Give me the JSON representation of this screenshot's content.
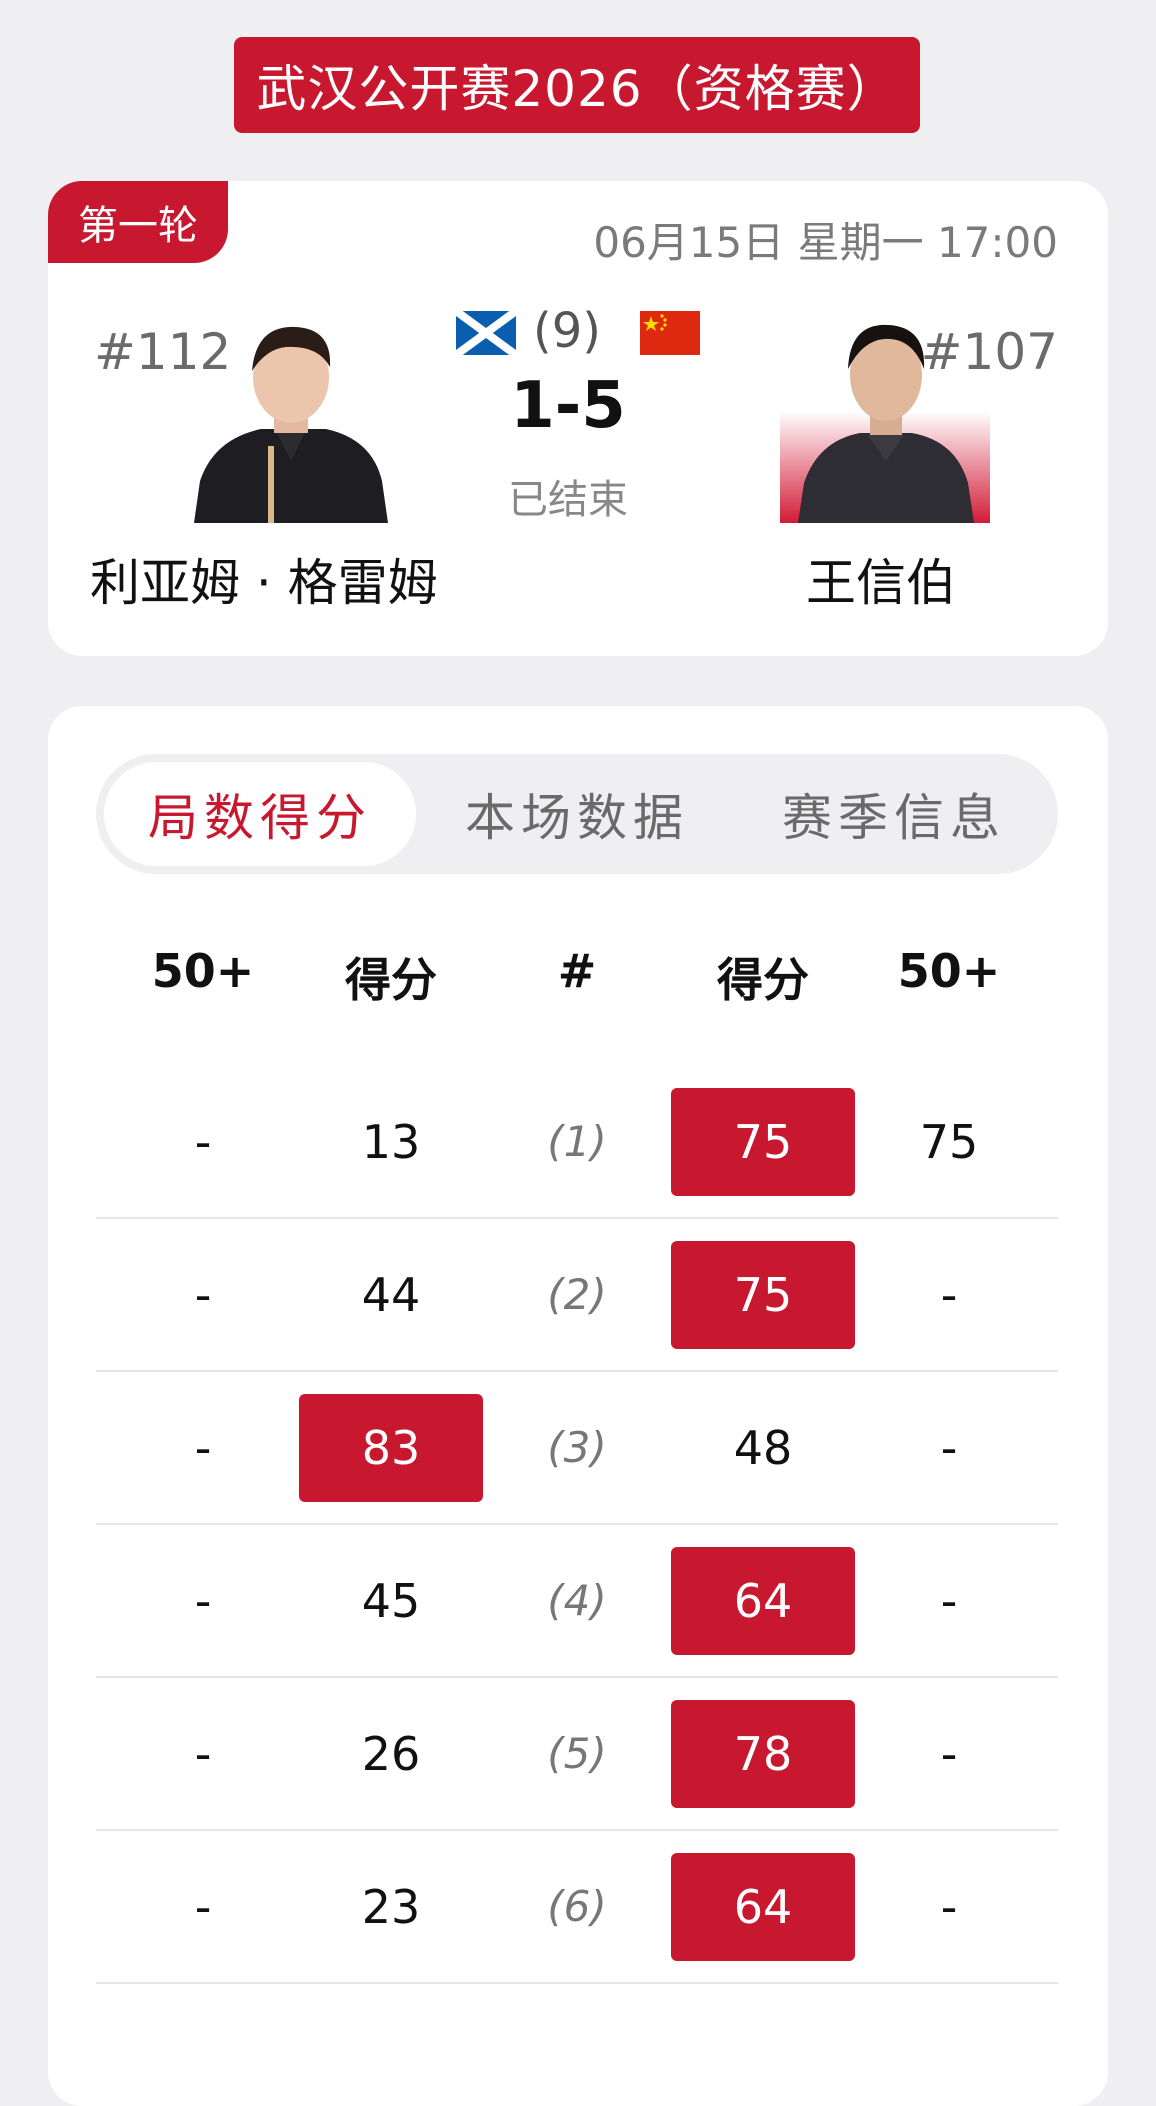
{
  "header": {
    "title": "武汉公开赛2026（资格赛）"
  },
  "match": {
    "round": "第一轮",
    "datetime": "06月15日 星期一 17:00",
    "best_of": "(9)",
    "score": "1-5",
    "status": "已结束",
    "left_player": {
      "rank": "#112",
      "name": "利亚姆 · 格雷姆",
      "flag": "scotland-flag-icon"
    },
    "right_player": {
      "rank": "#107",
      "name": "王信伯",
      "flag": "china-flag-icon"
    }
  },
  "tabs": [
    {
      "label": "局数得分",
      "active": true
    },
    {
      "label": "本场数据",
      "active": false
    },
    {
      "label": "赛季信息",
      "active": false
    }
  ],
  "frames": {
    "headers": [
      "50+",
      "得分",
      "#",
      "得分",
      "50+"
    ],
    "rows": [
      {
        "left_50": "-",
        "left_score": "13",
        "frame": "(1)",
        "right_score": "75",
        "right_50": "75",
        "winner": "right"
      },
      {
        "left_50": "-",
        "left_score": "44",
        "frame": "(2)",
        "right_score": "75",
        "right_50": "-",
        "winner": "right"
      },
      {
        "left_50": "-",
        "left_score": "83",
        "frame": "(3)",
        "right_score": "48",
        "right_50": "-",
        "winner": "left"
      },
      {
        "left_50": "-",
        "left_score": "45",
        "frame": "(4)",
        "right_score": "64",
        "right_50": "-",
        "winner": "right"
      },
      {
        "left_50": "-",
        "left_score": "26",
        "frame": "(5)",
        "right_score": "78",
        "right_50": "-",
        "winner": "right"
      },
      {
        "left_50": "-",
        "left_score": "23",
        "frame": "(6)",
        "right_score": "64",
        "right_50": "-",
        "winner": "right"
      }
    ]
  },
  "colors": {
    "accent": "#c8182f",
    "background": "#efeff2"
  }
}
